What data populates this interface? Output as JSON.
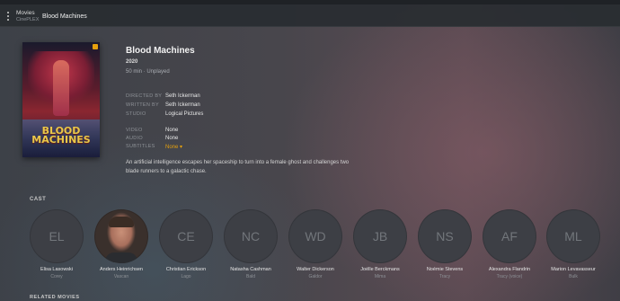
{
  "header": {
    "library_name": "Movies",
    "server_name": "CinePLEX",
    "title": "Blood Machines"
  },
  "poster": {
    "title_art": "BLOOD MACHINES"
  },
  "movie": {
    "title": "Blood Machines",
    "year": "2020",
    "duration_status": "50 min  ·  Unplayed"
  },
  "details": {
    "directed_by_label": "DIRECTED BY",
    "directed_by": "Seth Ickerman",
    "written_by_label": "WRITTEN BY",
    "written_by": "Seth Ickerman",
    "studio_label": "STUDIO",
    "studio": "Logical Pictures",
    "video_label": "VIDEO",
    "video": "None",
    "audio_label": "AUDIO",
    "audio": "None",
    "subtitles_label": "SUBTITLES",
    "subtitles": "None ▾"
  },
  "summary": "An artificial intelligence escapes her spaceship to turn into a female ghost and challenges two blade runners to a galactic chase.",
  "cast_section": {
    "label": "CAST",
    "members": [
      {
        "initials": "EL",
        "name": "Elisa Lasowski",
        "role": "Corey"
      },
      {
        "initials": "",
        "name": "Anders Heinrichsen",
        "role": "Vascan"
      },
      {
        "initials": "CE",
        "name": "Christian Erickson",
        "role": "Lago"
      },
      {
        "initials": "NC",
        "name": "Natasha Cashman",
        "role": "Bald"
      },
      {
        "initials": "WD",
        "name": "Walter Dickerson",
        "role": "Galdor"
      },
      {
        "initials": "JB",
        "name": "Joëlle Berckmans",
        "role": "Mima"
      },
      {
        "initials": "NS",
        "name": "Noémie Stevens",
        "role": "Tracy"
      },
      {
        "initials": "AF",
        "name": "Alexandra Flandrin",
        "role": "Tracy (voice)"
      },
      {
        "initials": "ML",
        "name": "Marion Levavasseur",
        "role": "Bulk"
      }
    ]
  },
  "related_label": "RELATED MOVIES",
  "colors": {
    "accent": "#e5a00d",
    "header_bg": "#282c31"
  }
}
